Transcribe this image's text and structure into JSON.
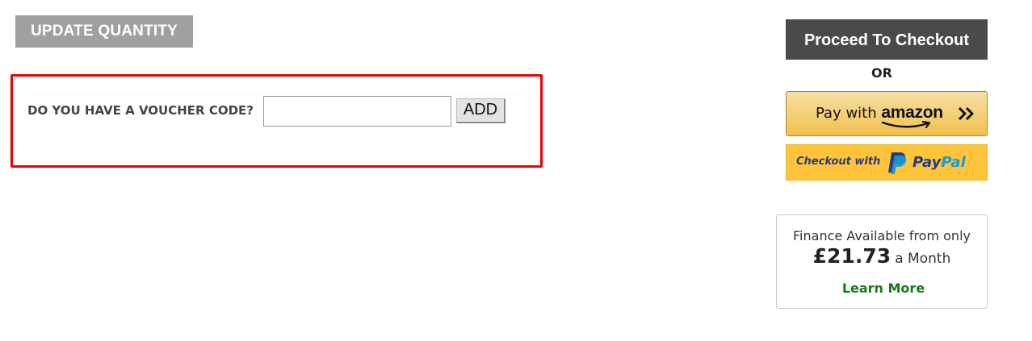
{
  "cart_actions": {
    "update_quantity_label": "UPDATE QUANTITY"
  },
  "voucher": {
    "label": "DO YOU HAVE A VOUCHER CODE?",
    "input_value": "",
    "input_placeholder": "",
    "add_label": "ADD",
    "highlight_color": "#ee0000"
  },
  "checkout": {
    "proceed_label": "Proceed To Checkout",
    "or_label": "OR",
    "amazon": {
      "pay_with": "Pay with",
      "brand": "amazon",
      "arrows_icon": "double-chevron-right-icon"
    },
    "paypal": {
      "checkout_with": "Checkout with",
      "brand_pay": "Pay",
      "brand_pal": "Pal",
      "logo_icon": "paypal-p-icon"
    }
  },
  "finance": {
    "line1": "Finance Available from only",
    "amount": "£21.73",
    "suffix": "a Month",
    "link_label": "Learn More",
    "link_color": "#1a7a1a"
  },
  "colors": {
    "update_button_bg": "#a0a0a0",
    "checkout_button_bg": "#4a4a4a",
    "amazon_button_bg": "#f0c14b",
    "paypal_button_bg": "#ffc439"
  }
}
